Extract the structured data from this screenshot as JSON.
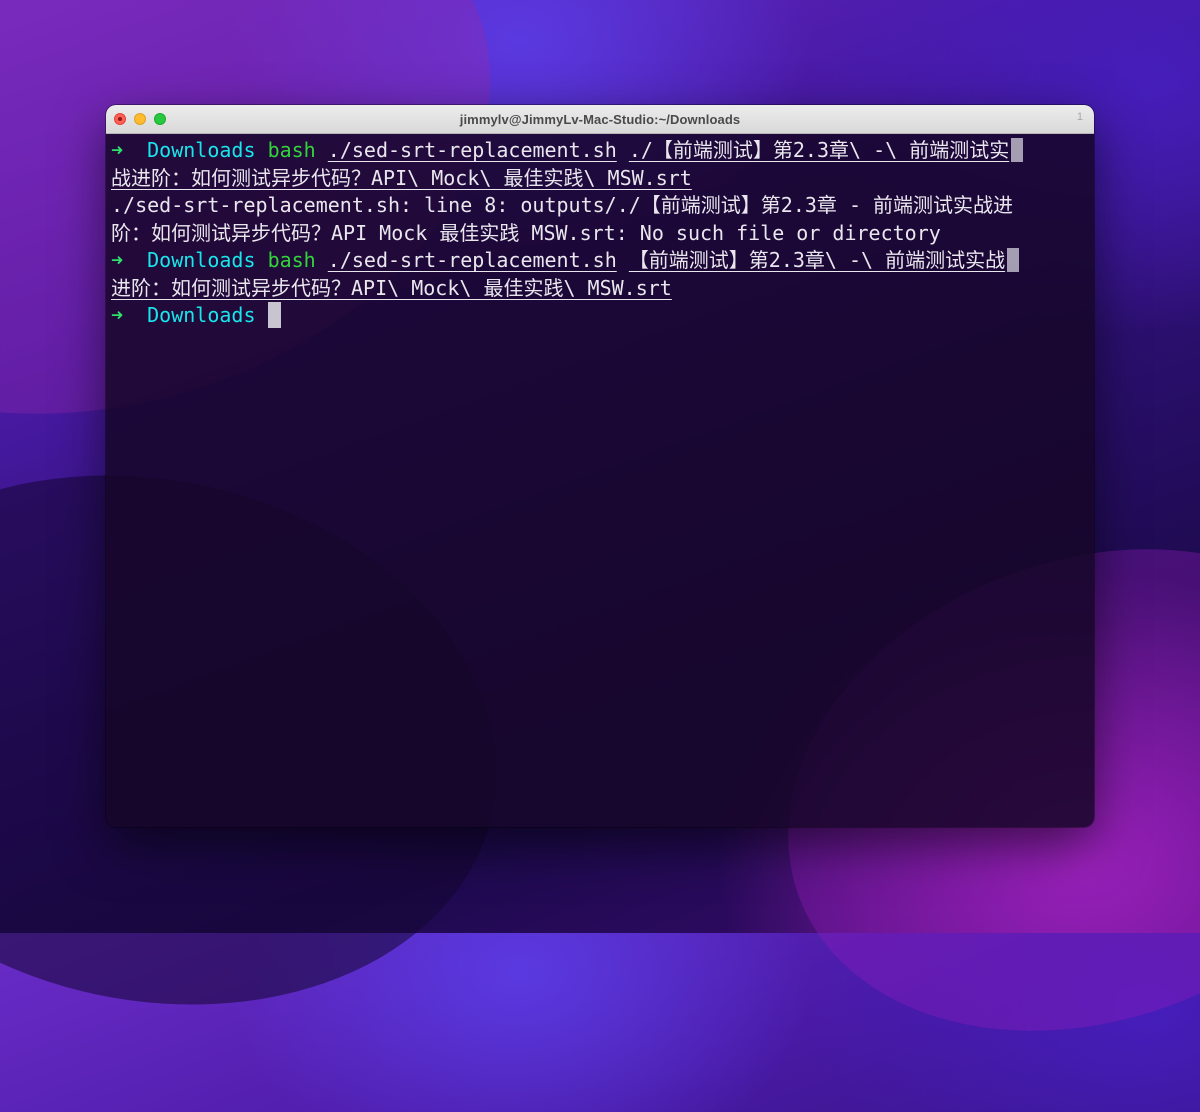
{
  "window": {
    "title": "jimmylv@JimmyLv-Mac-Studio:~/Downloads",
    "tab_index": "1"
  },
  "colors": {
    "prompt_arrow": "#2fe06a",
    "directory": "#19e6ea",
    "command": "#33d43a",
    "text": "#e9e6ee"
  },
  "terminal": {
    "prompt_arrow": "➜",
    "cwd": "Downloads",
    "entry1": {
      "command": "bash",
      "script": "./sed-srt-replacement.sh",
      "arg_part1": "./【前端测试】第2.3章\\ -\\ 前端测试实",
      "arg_part2": "战进阶：如何测试异步代码？API\\ Mock\\ 最佳实践\\ MSW.srt"
    },
    "error": {
      "line1": "./sed-srt-replacement.sh: line 8: outputs/./【前端测试】第2.3章 - 前端测试实战进",
      "line2": "阶：如何测试异步代码？API Mock 最佳实践 MSW.srt: No such file or directory"
    },
    "entry2": {
      "command": "bash",
      "script": "./sed-srt-replacement.sh",
      "arg_part1": "【前端测试】第2.3章\\ -\\ 前端测试实战",
      "arg_part2": "进阶：如何测试异步代码？API\\ Mock\\ 最佳实践\\ MSW.srt"
    }
  }
}
